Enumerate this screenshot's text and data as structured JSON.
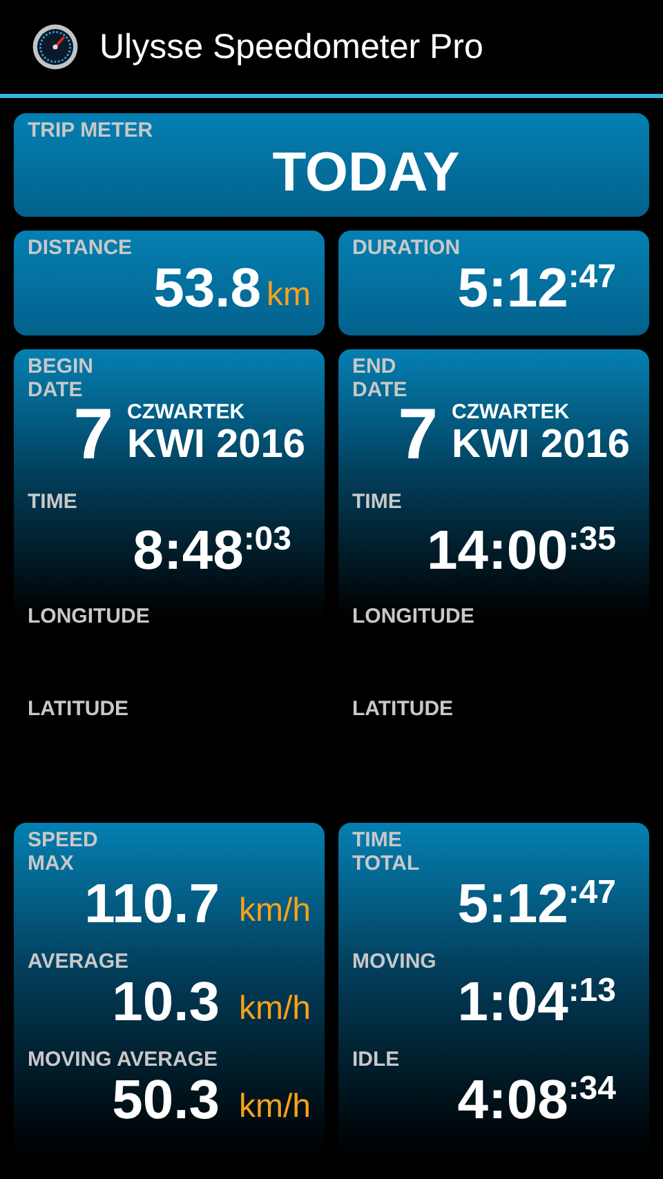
{
  "app_bar": {
    "title": "Ulysse Speedometer Pro"
  },
  "trip_meter": {
    "label": "TRIP METER",
    "value": "TODAY"
  },
  "distance": {
    "label": "DISTANCE",
    "value": "53.8",
    "unit": "km"
  },
  "duration": {
    "label": "DURATION",
    "value": "5:12",
    "seconds": ":47"
  },
  "endpoints": [
    {
      "title": "BEGIN",
      "date_label": "DATE",
      "day": "7",
      "weekday": "CZWARTEK",
      "month_year": "KWI 2016",
      "time_label": "TIME",
      "time": "8:48",
      "seconds": ":03",
      "longitude_label": "LONGITUDE",
      "latitude_label": "LATITUDE"
    },
    {
      "title": "END",
      "date_label": "DATE",
      "day": "7",
      "weekday": "CZWARTEK",
      "month_year": "KWI 2016",
      "time_label": "TIME",
      "time": "14:00",
      "seconds": ":35",
      "longitude_label": "LONGITUDE",
      "latitude_label": "LATITUDE"
    }
  ],
  "speed": {
    "title": "SPEED",
    "rows": [
      {
        "label": "MAX",
        "value": "110.7",
        "unit": "km/h"
      },
      {
        "label": "AVERAGE",
        "value": "10.3",
        "unit": "km/h"
      },
      {
        "label": "MOVING AVERAGE",
        "value": "50.3",
        "unit": "km/h"
      }
    ]
  },
  "time": {
    "title": "TIME",
    "rows": [
      {
        "label": "TOTAL",
        "value": "5:12",
        "seconds": ":47"
      },
      {
        "label": "MOVING",
        "value": "1:04",
        "seconds": ":13"
      },
      {
        "label": "IDLE",
        "value": "4:08",
        "seconds": ":34"
      }
    ]
  }
}
